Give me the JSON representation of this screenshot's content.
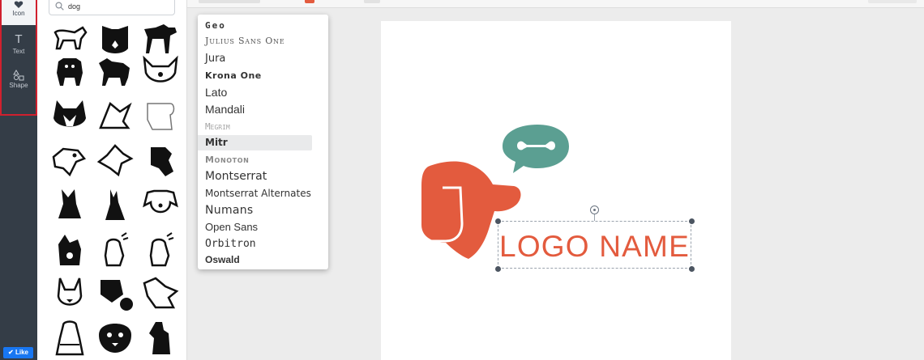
{
  "sidebar": {
    "items": [
      {
        "label": "Icon",
        "icon": "heart-icon",
        "active": true
      },
      {
        "label": "Text",
        "icon": "text-t-icon",
        "active": false
      },
      {
        "label": "Shape",
        "icon": "shapes-icon",
        "active": false
      }
    ],
    "like_label": "Like"
  },
  "search": {
    "value": "dog",
    "icon": "search-icon"
  },
  "icons": [
    {
      "name": "dog-walking-outline-icon"
    },
    {
      "name": "dog-face-heart-icon"
    },
    {
      "name": "dog-standing-icon"
    },
    {
      "name": "pug-silhouette-icon"
    },
    {
      "name": "retriever-silhouette-icon"
    },
    {
      "name": "dog-face-line-icon"
    },
    {
      "name": "husky-face-icon"
    },
    {
      "name": "dog-sitting-line-icon"
    },
    {
      "name": "dog-outline-abstract-icon"
    },
    {
      "name": "dog-head-outline-icon"
    },
    {
      "name": "fox-head-outline-icon"
    },
    {
      "name": "dog-head-solid-icon"
    },
    {
      "name": "dog-sitting-silhouette-icon"
    },
    {
      "name": "doberman-sitting-icon"
    },
    {
      "name": "beagle-face-line-icon"
    },
    {
      "name": "dog-paw-wave-icon"
    },
    {
      "name": "puppy-sitting-line-icon"
    },
    {
      "name": "puppy-sitting-line-2-icon"
    },
    {
      "name": "rabbit-dog-face-icon"
    },
    {
      "name": "dog-bubble-icon"
    },
    {
      "name": "dog-lying-line-icon"
    },
    {
      "name": "dog-sweater-icon"
    },
    {
      "name": "dog-face-round-icon"
    },
    {
      "name": "dog-sitting-tall-icon"
    }
  ],
  "font_menu": {
    "items": [
      {
        "label": "Geo"
      },
      {
        "label": "Julius Sans One"
      },
      {
        "label": "Jura"
      },
      {
        "label": "Krona One"
      },
      {
        "label": "Lato"
      },
      {
        "label": "Mandali"
      },
      {
        "label": "Megrim"
      },
      {
        "label": "Mitr",
        "selected": true
      },
      {
        "label": "Monoton"
      },
      {
        "label": "Montserrat"
      },
      {
        "label": "Montserrat Alternates"
      },
      {
        "label": "Numans"
      },
      {
        "label": "Open Sans"
      },
      {
        "label": "Orbitron"
      },
      {
        "label": "Oswald"
      }
    ]
  },
  "canvas": {
    "logo_text": "LOGO NAME",
    "colors": {
      "brand_orange": "#e35b3e",
      "bubble_teal": "#5b9f92"
    }
  }
}
